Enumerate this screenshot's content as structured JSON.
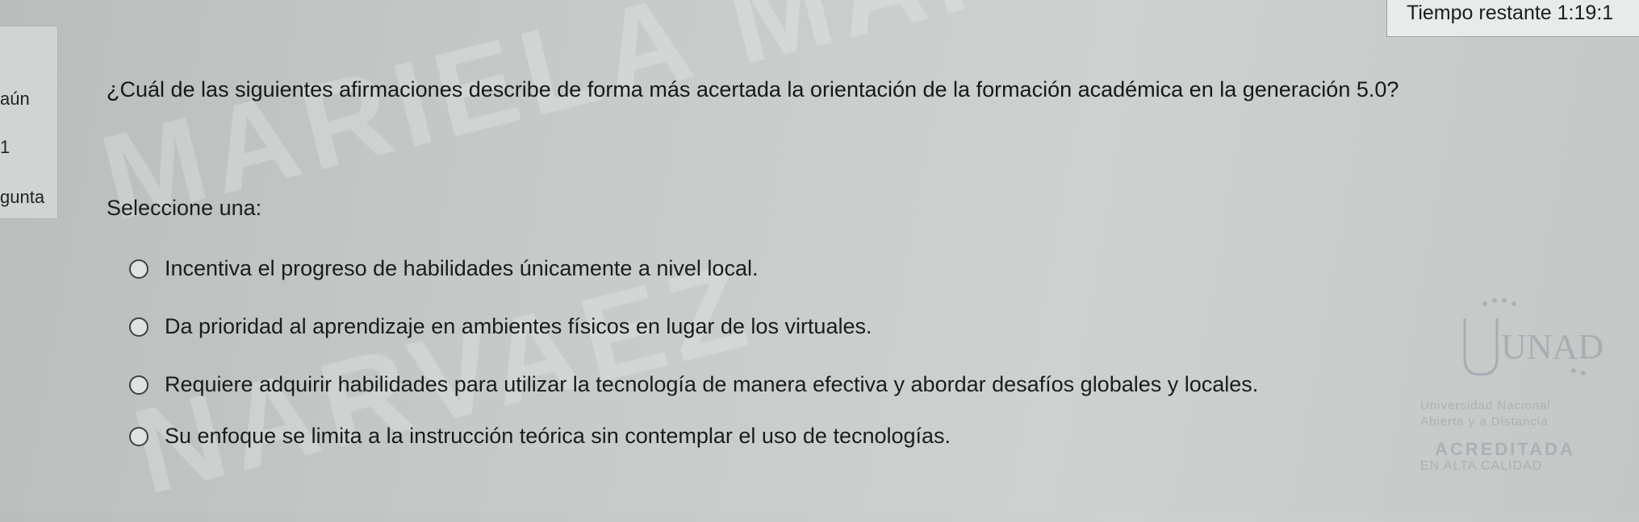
{
  "timer": {
    "label": "Tiempo restante 1:19:1"
  },
  "left_panel": {
    "line1": "aún",
    "line2": "1",
    "line3": "gunta"
  },
  "question": {
    "text": "¿Cuál de las siguientes afirmaciones describe de forma más acertada la orientación de la formación académica en la generación 5.0?",
    "prompt": "Seleccione una:",
    "options": [
      {
        "label": "Incentiva el progreso de habilidades únicamente a nivel local.",
        "selected": false
      },
      {
        "label": "Da prioridad al aprendizaje en ambientes físicos en lugar de los virtuales.",
        "selected": false
      },
      {
        "label": "Requiere adquirir habilidades para utilizar la tecnología de manera efectiva y abordar desafíos globales y locales.",
        "selected": false
      },
      {
        "label": "Su enfoque se limita a la instrucción teórica sin contemplar el uso de tecnologías.",
        "selected": false
      }
    ]
  },
  "watermark": {
    "line1": "MARIELA MARIA MARQUEZ",
    "line2": "NARVAEZ"
  },
  "logo": {
    "name": "UNAD",
    "line1": "Universidad Nacional",
    "line2": "Abierta y a Distancia",
    "line3": "ACREDITADA",
    "line4": "EN ALTA CALIDAD"
  },
  "colors": {
    "background": "#c6cac8",
    "timer_bg": "#e8ebea",
    "text": "#1c1f21"
  }
}
